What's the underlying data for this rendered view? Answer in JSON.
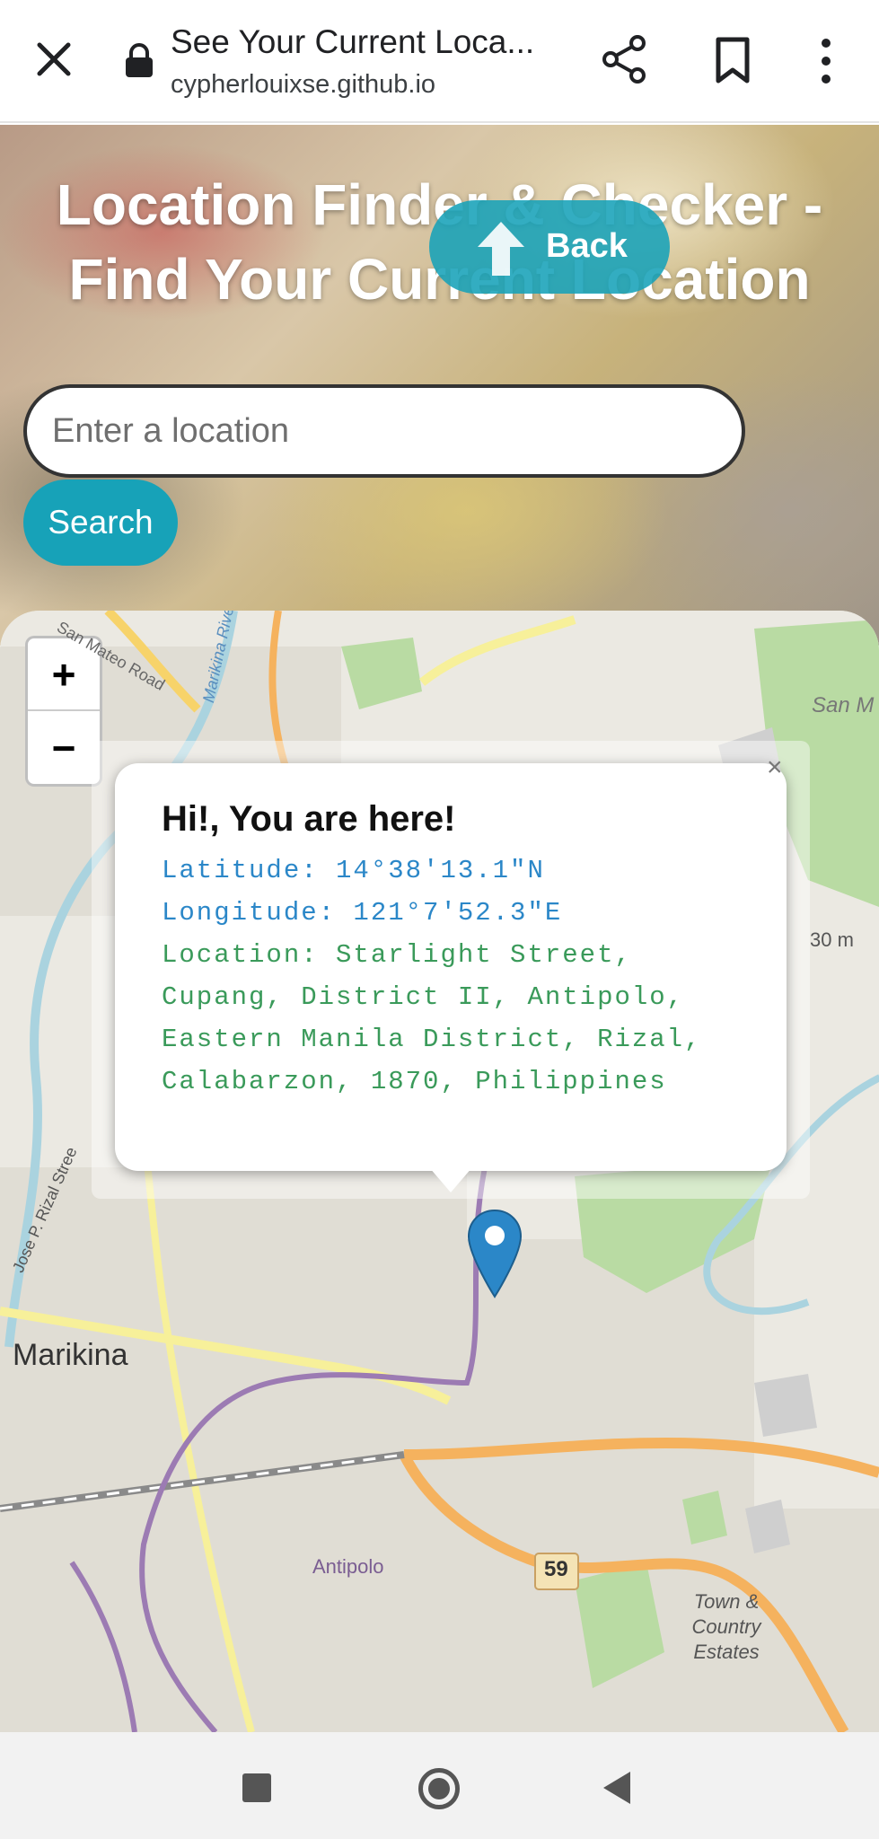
{
  "browser": {
    "title": "See Your Current Loca...",
    "url": "cypherlouixse.github.io"
  },
  "page": {
    "heading": "Location Finder & Checker - Find Your Current Location",
    "back_label": "Back",
    "search_placeholder": "Enter a location",
    "search_button": "Search"
  },
  "map": {
    "zoom_in": "+",
    "zoom_out": "−",
    "labels": {
      "marikina": "Marikina",
      "antipolo": "Antipolo",
      "town_country": "Town & Country Estates",
      "san_mateo": "San Mateo Road",
      "marikina_river": "Marikina River",
      "san_m": "San M",
      "rizal_street": "Jose P. Rizal Stree",
      "elev": "30 m",
      "route": "59"
    },
    "popup": {
      "close": "×",
      "heading": "Hi!, You are here!",
      "latitude": "Latitude: 14°38'13.1\"N",
      "longitude": "Longitude: 121°7'52.3\"E",
      "location": "Location: Starlight Street, Cupang, District II, Antipolo, Eastern Manila District, Rizal, Calabarzon, 1870, Philippines"
    }
  },
  "colors": {
    "accent": "#17a2b8",
    "marker": "#2b87c8",
    "coord_text": "#2b87c8",
    "location_text": "#3a9a5a"
  },
  "icons": {
    "close": "close-icon",
    "lock": "lock-icon",
    "share": "share-icon",
    "bookmark": "bookmark-icon",
    "menu": "more-vert-icon",
    "back": "arrow-up-icon",
    "marker": "map-marker-icon"
  }
}
